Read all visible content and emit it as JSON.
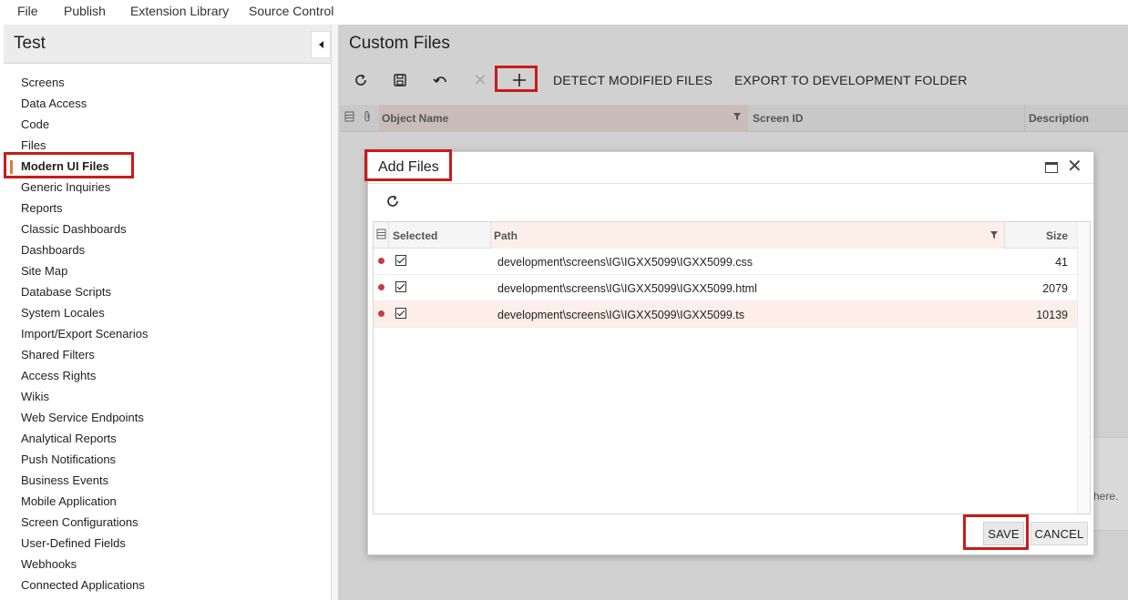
{
  "top_menu": {
    "items": [
      "File",
      "Publish",
      "Extension Library",
      "Source Control"
    ]
  },
  "left_panel": {
    "title": "Test",
    "items": [
      "Screens",
      "Data Access",
      "Code",
      "Files",
      "Modern UI Files",
      "Generic Inquiries",
      "Reports",
      "Classic Dashboards",
      "Dashboards",
      "Site Map",
      "Database Scripts",
      "System Locales",
      "Import/Export Scenarios",
      "Shared Filters",
      "Access Rights",
      "Wikis",
      "Web Service Endpoints",
      "Analytical Reports",
      "Push Notifications",
      "Business Events",
      "Mobile Application",
      "Screen Configurations",
      "User-Defined Fields",
      "Webhooks",
      "Connected Applications"
    ],
    "active_item": "Modern UI Files",
    "accent_color": "#e07b2c"
  },
  "main": {
    "title": "Custom Files",
    "toolbar": {
      "icons": [
        "refresh-icon",
        "save-icon",
        "undo-icon",
        "delete-icon",
        "add-icon"
      ],
      "detect_label": "DETECT MODIFIED FILES",
      "export_label": "EXPORT TO DEVELOPMENT FOLDER"
    },
    "grid_columns": [
      "Object Name",
      "Screen ID",
      "Description"
    ],
    "partial_text": "here."
  },
  "dialog": {
    "title": "Add Files",
    "columns": {
      "selected": "Selected",
      "path": "Path",
      "size": "Size"
    },
    "rows": [
      {
        "path": "development\\screens\\IG\\IGXX5099\\IGXX5099.css",
        "size": "41",
        "selected": true
      },
      {
        "path": "development\\screens\\IG\\IGXX5099\\IGXX5099.html",
        "size": "2079",
        "selected": true
      },
      {
        "path": "development\\screens\\IG\\IGXX5099\\IGXX5099.ts",
        "size": "10139",
        "selected": true
      }
    ],
    "save_label": "SAVE",
    "cancel_label": "CANCEL"
  },
  "colors": {
    "highlight_box": "#c81b1b",
    "modified_dot": "#c73a43",
    "overlay": "#d1d1d1"
  }
}
